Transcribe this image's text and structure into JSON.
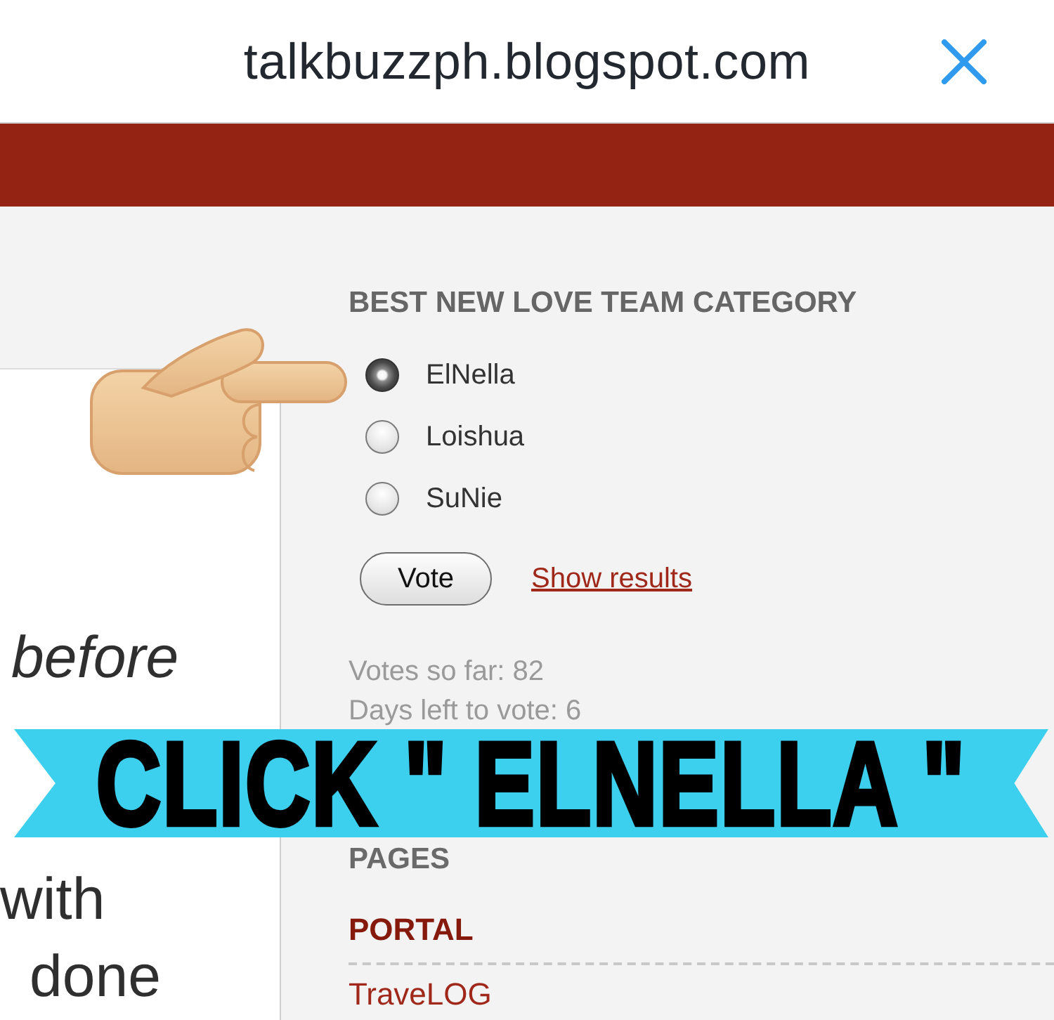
{
  "top_bar": {
    "url": "talkbuzzph.blogspot.com"
  },
  "post_fragments": [
    {
      "text": "before",
      "kind": "italic"
    },
    {
      "text": "with",
      "kind": "plain"
    },
    {
      "text": "done",
      "kind": "plain"
    }
  ],
  "poll": {
    "title": "BEST NEW LOVE TEAM CATEGORY",
    "options": [
      {
        "label": "ElNella",
        "selected": true
      },
      {
        "label": "Loishua",
        "selected": false
      },
      {
        "label": "SuNie",
        "selected": false
      }
    ],
    "vote_button": "Vote",
    "results_link": "Show results",
    "votes_so_far": "Votes so far: 82",
    "days_left": "Days left to vote: 6"
  },
  "overlay_banner": {
    "text": "CLICK \" ELNELLA \""
  },
  "pages": {
    "title": "PAGES",
    "items": [
      {
        "label": "PORTAL",
        "selected": true
      },
      {
        "label": "TraveLOG",
        "selected": false
      }
    ]
  }
}
